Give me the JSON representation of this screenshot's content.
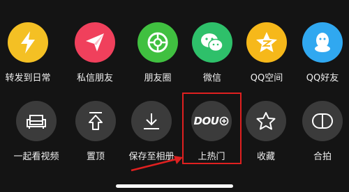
{
  "share_row": [
    {
      "label": "转发到日常",
      "icon": "lightning-icon",
      "color": "#f4c024"
    },
    {
      "label": "私信朋友",
      "icon": "paper-plane-icon",
      "color": "#f0405c"
    },
    {
      "label": "朋友圈",
      "icon": "moments-icon",
      "color": "#40c040"
    },
    {
      "label": "微信",
      "icon": "wechat-icon",
      "color": "#2ec06a"
    },
    {
      "label": "QQ空间",
      "icon": "qzone-icon",
      "color": "#f6b81a"
    },
    {
      "label": "QQ好友",
      "icon": "qq-icon",
      "color": "#30a8f0"
    }
  ],
  "action_row": [
    {
      "label": "一起看视频",
      "icon": "sofa-icon"
    },
    {
      "label": "置顶",
      "icon": "pin-top-icon"
    },
    {
      "label": "保存至相册",
      "icon": "download-icon"
    },
    {
      "label": "上热门",
      "icon": "dou-plus-icon",
      "logo_text": "DOU"
    },
    {
      "label": "收藏",
      "icon": "star-icon"
    },
    {
      "label": "合拍",
      "icon": "duet-icon"
    }
  ],
  "colors": {
    "background": "#141414",
    "icon_bg": "#3b3b3b",
    "highlight": "#e02020"
  }
}
